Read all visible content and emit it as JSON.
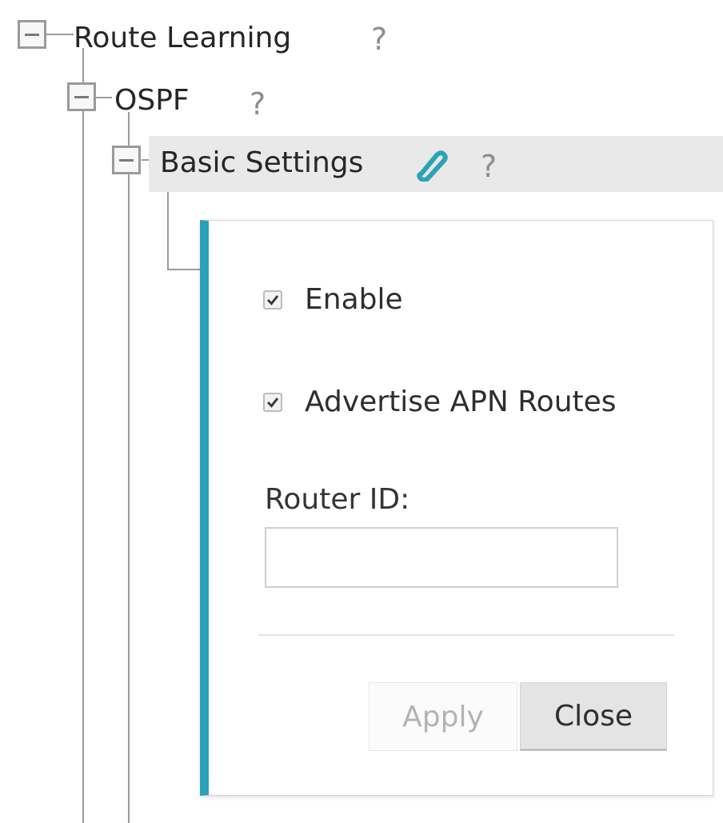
{
  "tree": {
    "route_learning": {
      "label": "Route Learning",
      "help": "?"
    },
    "ospf": {
      "label": "OSPF",
      "help": "?"
    },
    "basic_settings": {
      "label": "Basic Settings",
      "help": "?",
      "edit_icon": "pencil-icon"
    }
  },
  "panel": {
    "accent_color": "#2aa3b8",
    "enable": {
      "label": "Enable",
      "checked": true
    },
    "advertise_apn_routes": {
      "label": "Advertise APN Routes",
      "checked": true
    },
    "router_id": {
      "label": "Router ID:",
      "value": "",
      "placeholder": ""
    },
    "buttons": {
      "apply": "Apply",
      "close": "Close"
    }
  }
}
